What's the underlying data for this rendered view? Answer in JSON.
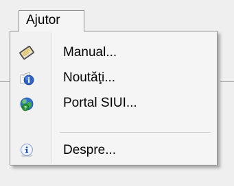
{
  "menu": {
    "title": "Ajutor",
    "items": [
      {
        "label": "Manual...",
        "icon": "manual-book-icon"
      },
      {
        "label": "Noutăţi...",
        "icon": "news-info-icon"
      },
      {
        "label": "Portal SIUI...",
        "icon": "portal-globe-icon"
      },
      {
        "label": "Despre...",
        "icon": "about-info-icon"
      }
    ]
  }
}
